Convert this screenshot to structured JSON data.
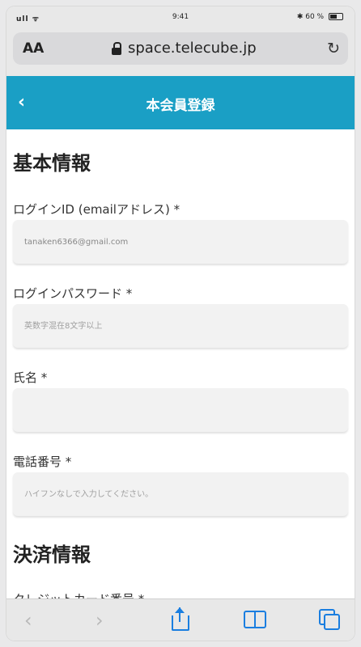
{
  "status_bar": {
    "signal": "ull ᯤ",
    "time": "9:41",
    "battery": "✱ 60 %"
  },
  "browser": {
    "aa_label": "AA",
    "url": "space.telecube.jp"
  },
  "header": {
    "title": "本会員登録"
  },
  "sections": {
    "basic_info": "基本情報",
    "payment_info": "決済情報"
  },
  "fields": {
    "login_id": {
      "label": "ログインID (emailアドレス) *",
      "value": "tanaken6366@gmail.com"
    },
    "password": {
      "label": "ログインパスワード *",
      "placeholder": "英数字混在8文字以上"
    },
    "name": {
      "label": "氏名 *",
      "placeholder": ""
    },
    "phone": {
      "label": "電話番号 *",
      "placeholder": "ハイフンなしで入力してください。"
    },
    "card_number": {
      "label": "クレジットカード番号 *"
    }
  },
  "colors": {
    "accent": "#1a9fc5",
    "toolbar_blue": "#1a7ee0"
  },
  "toolbar": {
    "icons": [
      "chevron-left-icon",
      "chevron-right-icon",
      "share-icon",
      "bookmarks-icon",
      "tabs-icon"
    ]
  }
}
